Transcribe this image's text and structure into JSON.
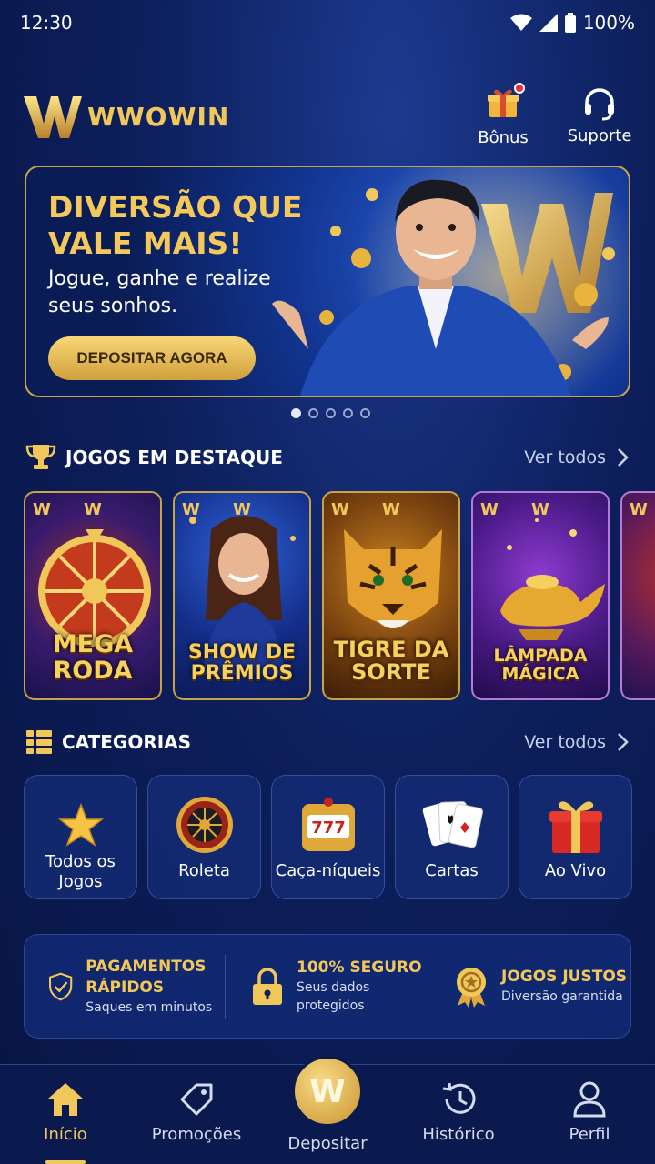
{
  "status": {
    "time": "12:30",
    "battery": "100%"
  },
  "header": {
    "brand": "WWOWIN",
    "bonus_label": "Bônus",
    "support_label": "Suporte"
  },
  "banner": {
    "title": "DIVERSÃO QUE VALE MAIS!",
    "subtitle": "Jogue, ganhe e realize seus sonhos.",
    "cta": "DEPOSITAR AGORA",
    "pages": 5,
    "active_page": 1
  },
  "featured": {
    "title": "JOGOS EM DESTAQUE",
    "see_all": "Ver todos",
    "games": [
      {
        "name": "MEGA RODA",
        "badge": "W"
      },
      {
        "name": "SHOW DE PRÊMIOS",
        "badge": "W"
      },
      {
        "name": "TIGRE DA SORTE",
        "badge": "W"
      },
      {
        "name": "LÂMPADA MÁGICA",
        "badge": "W"
      }
    ]
  },
  "categories": {
    "title": "CATEGORIAS",
    "see_all": "Ver todos",
    "items": [
      {
        "label": "Todos os Jogos",
        "icon": "star-icon"
      },
      {
        "label": "Roleta",
        "icon": "roulette-icon"
      },
      {
        "label": "Caça-níqueis",
        "icon": "slot-machine-icon"
      },
      {
        "label": "Cartas",
        "icon": "cards-icon"
      },
      {
        "label": "Ao Vivo",
        "icon": "gift-box-icon"
      }
    ]
  },
  "trust": [
    {
      "title": "PAGAMENTOS RÁPIDOS",
      "subtitle": "Saques em minutos",
      "icon": "shield-check-icon"
    },
    {
      "title": "100% SEGURO",
      "subtitle": "Seus dados protegidos",
      "icon": "lock-icon"
    },
    {
      "title": "JOGOS JUSTOS",
      "subtitle": "Diversão garantida",
      "icon": "award-badge-icon"
    }
  ],
  "nav": {
    "home": "Início",
    "promotions": "Promoções",
    "deposit": "Depositar",
    "deposit_badge": "W",
    "history": "Histórico",
    "profile": "Perfil"
  },
  "colors": {
    "gold": "#f2c75a",
    "navy": "#0d1f5c",
    "accent_blue": "#2a61d8"
  }
}
